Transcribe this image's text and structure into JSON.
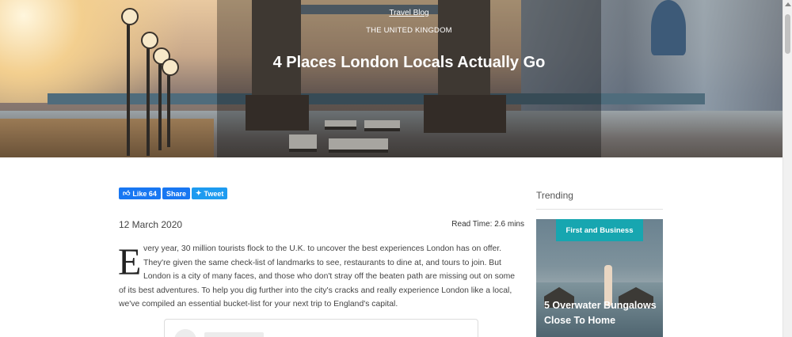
{
  "hero": {
    "category": "Travel Blog",
    "region": "THE UNITED KINGDOM",
    "title": "4 Places London Locals Actually Go"
  },
  "share": {
    "like_label": "Like 64",
    "share_label": "Share",
    "tweet_label": "Tweet"
  },
  "article": {
    "date": "12 March 2020",
    "read_time": "Read Time: 2.6 mins",
    "dropcap": "E",
    "intro_first": "very year, 30 million tourists flock to the U.K. to uncover the best experiences London has on offer. They're given the same check-list of landmarks to see, restaurants to dine at, and tours to join. But London is a city of many faces, and those who don't stray off the beaten path are missing out on some",
    "intro_rest": "of its best adventures. To help you dig further into the city's cracks and really experience London like a local, we've compiled an essential bucket-list for your next trip to England's capital."
  },
  "sidebar": {
    "heading": "Trending",
    "card": {
      "badge": "First and Business",
      "title": "5 Overwater Bungalows Close To Home"
    }
  },
  "colors": {
    "facebook": "#1877f2",
    "twitter": "#1d9bf0",
    "badge_teal": "#17a6b0"
  }
}
